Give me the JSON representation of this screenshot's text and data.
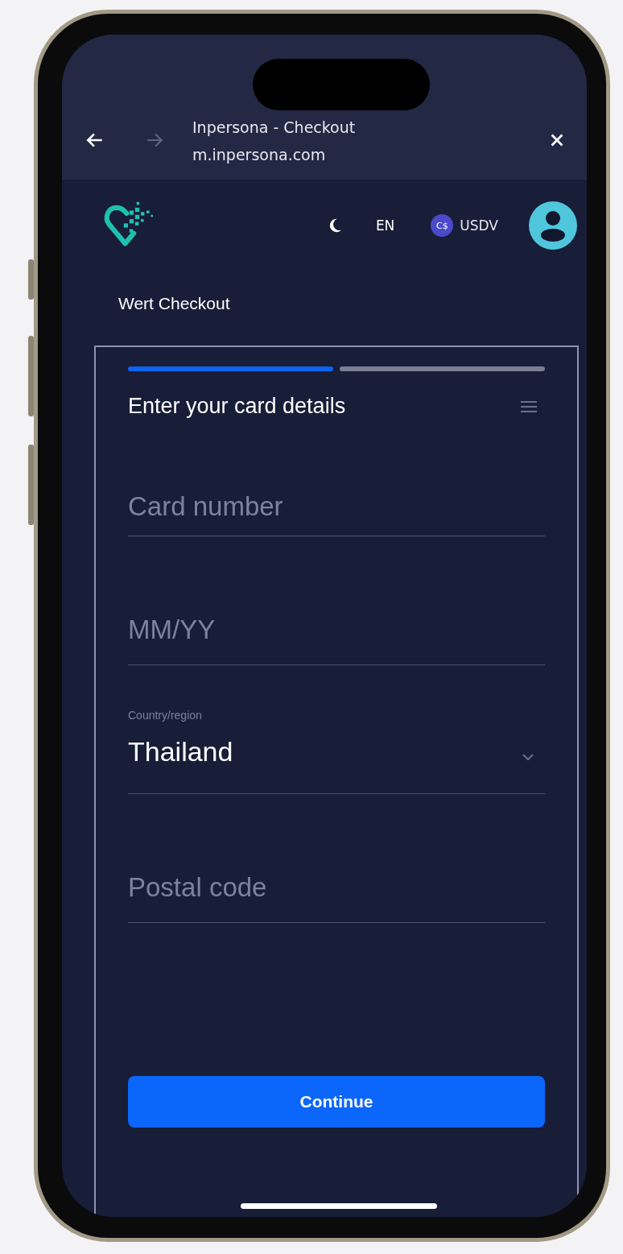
{
  "browser_bar": {
    "title": "Inpersona - Checkout",
    "url": "m.inpersona.com",
    "back_disabled": false,
    "forward_disabled": true
  },
  "header": {
    "language": "EN",
    "currency": "USDV",
    "currency_symbol": "C$"
  },
  "page_title": "Wert Checkout",
  "checkout": {
    "steps": [
      {
        "done": true
      },
      {
        "done": false
      }
    ],
    "heading": "Enter your card details",
    "fields": [
      {
        "kind": "text",
        "placeholder": "Card number"
      },
      {
        "kind": "text",
        "placeholder": "MM/YY"
      },
      {
        "kind": "select",
        "label": "Country/region",
        "value": "Thailand"
      },
      {
        "kind": "text",
        "placeholder": "Postal code"
      }
    ],
    "button": "Continue"
  }
}
